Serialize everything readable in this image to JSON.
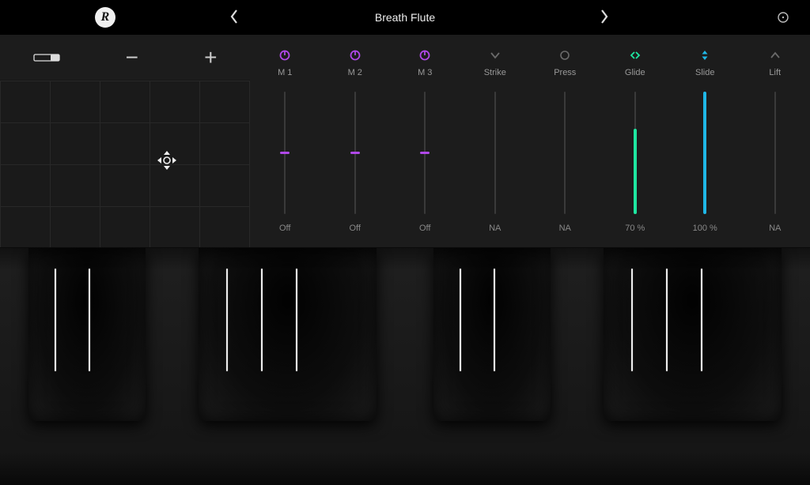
{
  "header": {
    "title": "Breath Flute"
  },
  "tools": {
    "minus": "−",
    "plus": "+"
  },
  "colors": {
    "purple": "#b048e8",
    "green": "#1ee6a0",
    "cyan": "#1fb7e6",
    "gray": "#6a6a6a"
  },
  "sliders": [
    {
      "id": "m1",
      "label": "M 1",
      "value": "Off",
      "icon": "knob",
      "color": "#b048e8",
      "fill_pct": 0,
      "thumb_pct": 50,
      "thumb_color": "#b048e8"
    },
    {
      "id": "m2",
      "label": "M 2",
      "value": "Off",
      "icon": "knob",
      "color": "#b048e8",
      "fill_pct": 0,
      "thumb_pct": 50,
      "thumb_color": "#b048e8"
    },
    {
      "id": "m3",
      "label": "M 3",
      "value": "Off",
      "icon": "knob",
      "color": "#b048e8",
      "fill_pct": 0,
      "thumb_pct": 50,
      "thumb_color": "#b048e8"
    },
    {
      "id": "strike",
      "label": "Strike",
      "value": "NA",
      "icon": "strike",
      "color": "#6a6a6a",
      "fill_pct": 0,
      "thumb_pct": null,
      "thumb_color": null
    },
    {
      "id": "press",
      "label": "Press",
      "value": "NA",
      "icon": "press",
      "color": "#6a6a6a",
      "fill_pct": 0,
      "thumb_pct": null,
      "thumb_color": null
    },
    {
      "id": "glide",
      "label": "Glide",
      "value": "70 %",
      "icon": "glide",
      "color": "#1ee6a0",
      "fill_pct": 70,
      "thumb_pct": null,
      "thumb_color": null
    },
    {
      "id": "slide",
      "label": "Slide",
      "value": "100 %",
      "icon": "slide",
      "color": "#1fb7e6",
      "fill_pct": 100,
      "thumb_pct": null,
      "thumb_color": null
    },
    {
      "id": "lift",
      "label": "Lift",
      "value": "NA",
      "icon": "lift",
      "color": "#6a6a6a",
      "fill_pct": 0,
      "thumb_pct": null,
      "thumb_color": null
    }
  ],
  "keyboard": {
    "white_key_count": 14,
    "black_groups": [
      {
        "left_pct": 3.5,
        "width_pct": 14.5,
        "markers_pct": [
          6.8,
          11.0
        ]
      },
      {
        "left_pct": 24.5,
        "width_pct": 22.0,
        "markers_pct": [
          28.0,
          32.3,
          36.6
        ]
      },
      {
        "left_pct": 53.5,
        "width_pct": 14.5,
        "markers_pct": [
          56.8,
          61.0
        ]
      },
      {
        "left_pct": 74.5,
        "width_pct": 22.0,
        "markers_pct": [
          78.0,
          82.3,
          86.6
        ]
      }
    ]
  }
}
